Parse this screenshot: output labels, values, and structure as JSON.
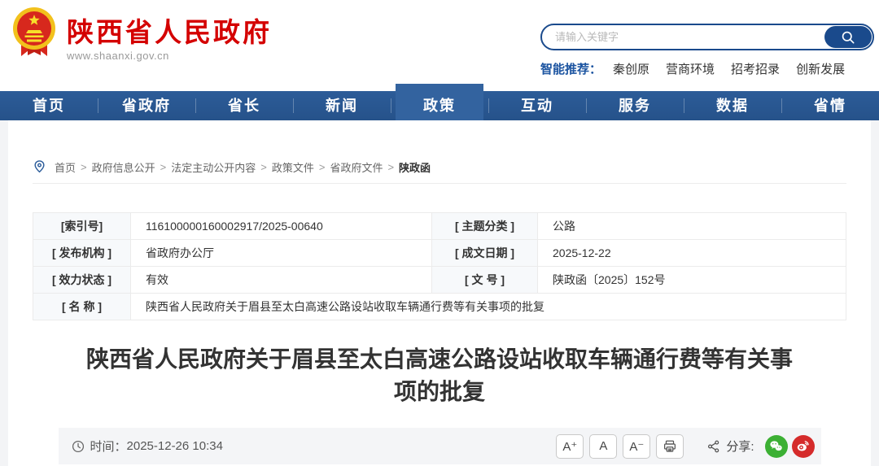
{
  "site": {
    "name": "陕西省人民政府",
    "url": "www.shaanxi.gov.cn"
  },
  "colors": {
    "brand_red": "#d40000",
    "nav_blue": "#2c5c98",
    "nav_active_blue": "#33639f",
    "accent_blue": "#1a4a8c",
    "wechat_green": "#3cb034",
    "weibo_red": "#d52b2b"
  },
  "icons": {
    "emblem": "china-national-emblem",
    "search": "magnifier",
    "breadcrumb_pin": "location-pin",
    "time": "clock",
    "print": "printer",
    "share": "share-nodes",
    "wechat": "wechat-logo",
    "weibo": "weibo-logo"
  },
  "search": {
    "placeholder": "请输入关键字",
    "recommend_label": "智能推荐：",
    "hot_words": [
      "秦创原",
      "营商环境",
      "招考招录",
      "创新发展"
    ]
  },
  "nav": {
    "active": "政策",
    "items": [
      "首页",
      "省政府",
      "省长",
      "新闻",
      "政策",
      "互动",
      "服务",
      "数据",
      "省情"
    ]
  },
  "breadcrumb": {
    "separator": ">",
    "items": [
      "首页",
      "政府信息公开",
      "法定主动公开内容",
      "政策文件",
      "省政府文件",
      "陕政函"
    ]
  },
  "meta": {
    "index_label": "[索引号]",
    "index_value": "116100000160002917/2025-00640",
    "topic_label": "[ 主题分类 ]",
    "topic_value": "公路",
    "issuer_label": "[ 发布机构 ]",
    "issuer_value": "省政府办公厅",
    "date_label": "[ 成文日期 ]",
    "date_value": "2025-12-22",
    "validity_label": "[ 效力状态 ]",
    "validity_value": "有效",
    "docnum_label": "[ 文 号 ]",
    "docnum_value": "陕政函〔2025〕152号",
    "name_label": "[ 名 称 ]",
    "name_value": "陕西省人民政府关于眉县至太白高速公路设站收取车辆通行费等有关事项的批复"
  },
  "article": {
    "title": "陕西省人民政府关于眉县至太白高速公路设站收取车辆通行费等有关事项的批复",
    "time_label": "时间：",
    "time_value": "2025-12-26 10:34",
    "font_larger": "A⁺",
    "font_normal": "A",
    "font_smaller": "A⁻",
    "share_label": "分享:"
  }
}
